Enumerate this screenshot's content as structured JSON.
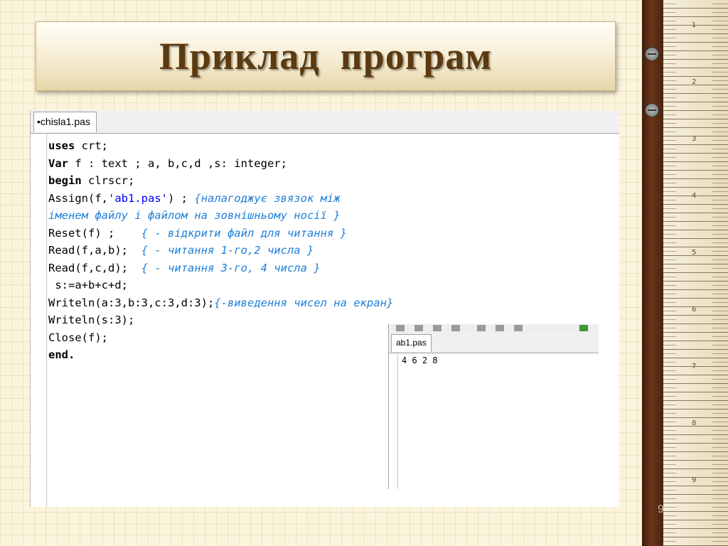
{
  "slide": {
    "title": "Приклад  програм",
    "page_number": "9"
  },
  "editor": {
    "tab_label": "•chisla1.pas",
    "lines": [
      [
        {
          "t": "uses",
          "c": "kw"
        },
        {
          "t": " crt;",
          "c": ""
        }
      ],
      [
        {
          "t": "Var",
          "c": "kw"
        },
        {
          "t": " f : text ; a, b,c,d ,s: integer;",
          "c": ""
        }
      ],
      [
        {
          "t": "begin",
          "c": "kw"
        },
        {
          "t": " clrscr;",
          "c": ""
        }
      ],
      [
        {
          "t": "Assign(f,",
          "c": ""
        },
        {
          "t": "'ab1.pas'",
          "c": "str"
        },
        {
          "t": ") ; ",
          "c": ""
        },
        {
          "t": "{налагоджує звязок між",
          "c": "cm"
        }
      ],
      [
        {
          "t": "іменем файлу і файлом на зовнішньому носії }",
          "c": "cm"
        }
      ],
      [
        {
          "t": "Reset(f) ;    ",
          "c": ""
        },
        {
          "t": "{ - відкрити файл для читання }",
          "c": "cm"
        }
      ],
      [
        {
          "t": "Read(f,a,b);  ",
          "c": ""
        },
        {
          "t": "{ - читання 1-го,2 числа }",
          "c": "cm"
        }
      ],
      [
        {
          "t": "Read(f,c,d);  ",
          "c": ""
        },
        {
          "t": "{ - читання 3-го, 4 числа }",
          "c": "cm"
        }
      ],
      [
        {
          "t": " s:=a+b+c+d;",
          "c": ""
        }
      ],
      [
        {
          "t": "Writeln(a:3,b:3,c:3,d:3);",
          "c": ""
        },
        {
          "t": "{-виведення чисел на екран}",
          "c": "cm"
        }
      ],
      [
        {
          "t": "Writeln(s:3);",
          "c": ""
        }
      ],
      [
        {
          "t": "Close(f);",
          "c": ""
        }
      ],
      [
        {
          "t": "end.",
          "c": "kw"
        }
      ]
    ]
  },
  "output": {
    "tab_label": "ab1.pas",
    "content": "4 6 2 8"
  },
  "colors": {
    "title": "#5b3a10",
    "comment": "#1f7fd8",
    "string": "#0000ff"
  }
}
